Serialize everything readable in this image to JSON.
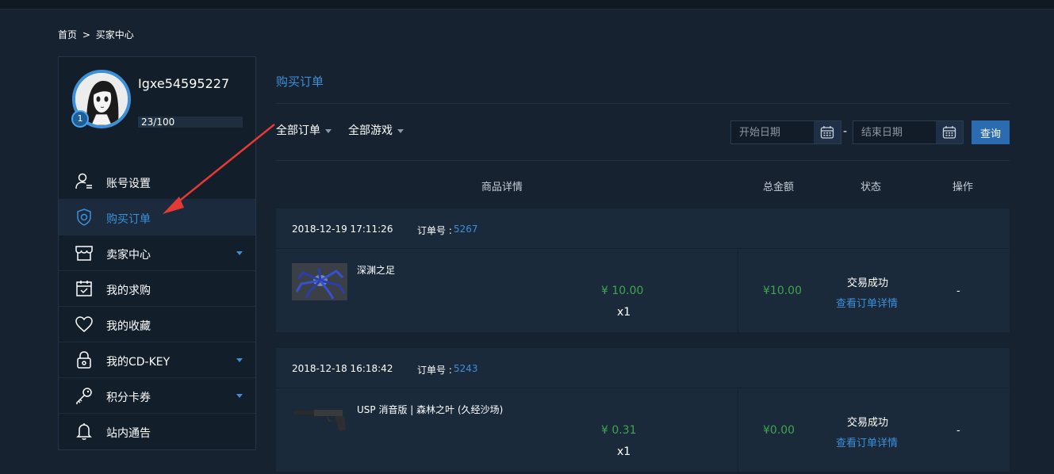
{
  "breadcrumb": {
    "home": "首页",
    "sep": ">",
    "current": "买家中心"
  },
  "profile": {
    "username": "Igxe54595227",
    "level": "1",
    "xp_text": "23/100",
    "xp_progress": 0.23
  },
  "sidebar": {
    "items": [
      {
        "label": "账号设置",
        "icon": "user-settings-icon",
        "active": false,
        "expandable": false
      },
      {
        "label": "购买订单",
        "icon": "shield-icon",
        "active": true,
        "expandable": false
      },
      {
        "label": "卖家中心",
        "icon": "store-icon",
        "active": false,
        "expandable": true
      },
      {
        "label": "我的求购",
        "icon": "calendar-check-icon",
        "active": false,
        "expandable": false
      },
      {
        "label": "我的收藏",
        "icon": "heart-icon",
        "active": false,
        "expandable": false
      },
      {
        "label": "我的CD-KEY",
        "icon": "lock-icon",
        "active": false,
        "expandable": true
      },
      {
        "label": "积分卡券",
        "icon": "key-icon",
        "active": false,
        "expandable": true
      },
      {
        "label": "站内通告",
        "icon": "bell-icon",
        "active": false,
        "expandable": false
      }
    ]
  },
  "main": {
    "title": "购买订单",
    "filters": {
      "order_type": "全部订单",
      "game": "全部游戏"
    },
    "date": {
      "start_placeholder": "开始日期",
      "end_placeholder": "结束日期",
      "separator": "-"
    },
    "query_label": "查询",
    "columns": {
      "details": "商品详情",
      "total": "总金额",
      "status": "状态",
      "action": "操作"
    },
    "orders": [
      {
        "time": "2018-12-19 17:11:26",
        "order_no_label": "订单号 :",
        "order_no": "5267",
        "item_name": "深渊之足",
        "price": "¥ 10.00",
        "qty": "x1",
        "total": "¥10.00",
        "status": "交易成功",
        "detail_link": "查看订单详情",
        "action": "-"
      },
      {
        "time": "2018-12-18 16:18:42",
        "order_no_label": "订单号 :",
        "order_no": "5243",
        "item_name": "USP 消音版 | 森林之叶 (久经沙场)",
        "price": "¥ 0.31",
        "qty": "x1",
        "total": "¥0.00",
        "status": "交易成功",
        "detail_link": "查看订单详情",
        "action": "-"
      }
    ]
  },
  "colors": {
    "accent": "#3d8fd8",
    "price_green": "#3fa54c",
    "annotation_arrow": "#e53935",
    "background": "#172230"
  }
}
